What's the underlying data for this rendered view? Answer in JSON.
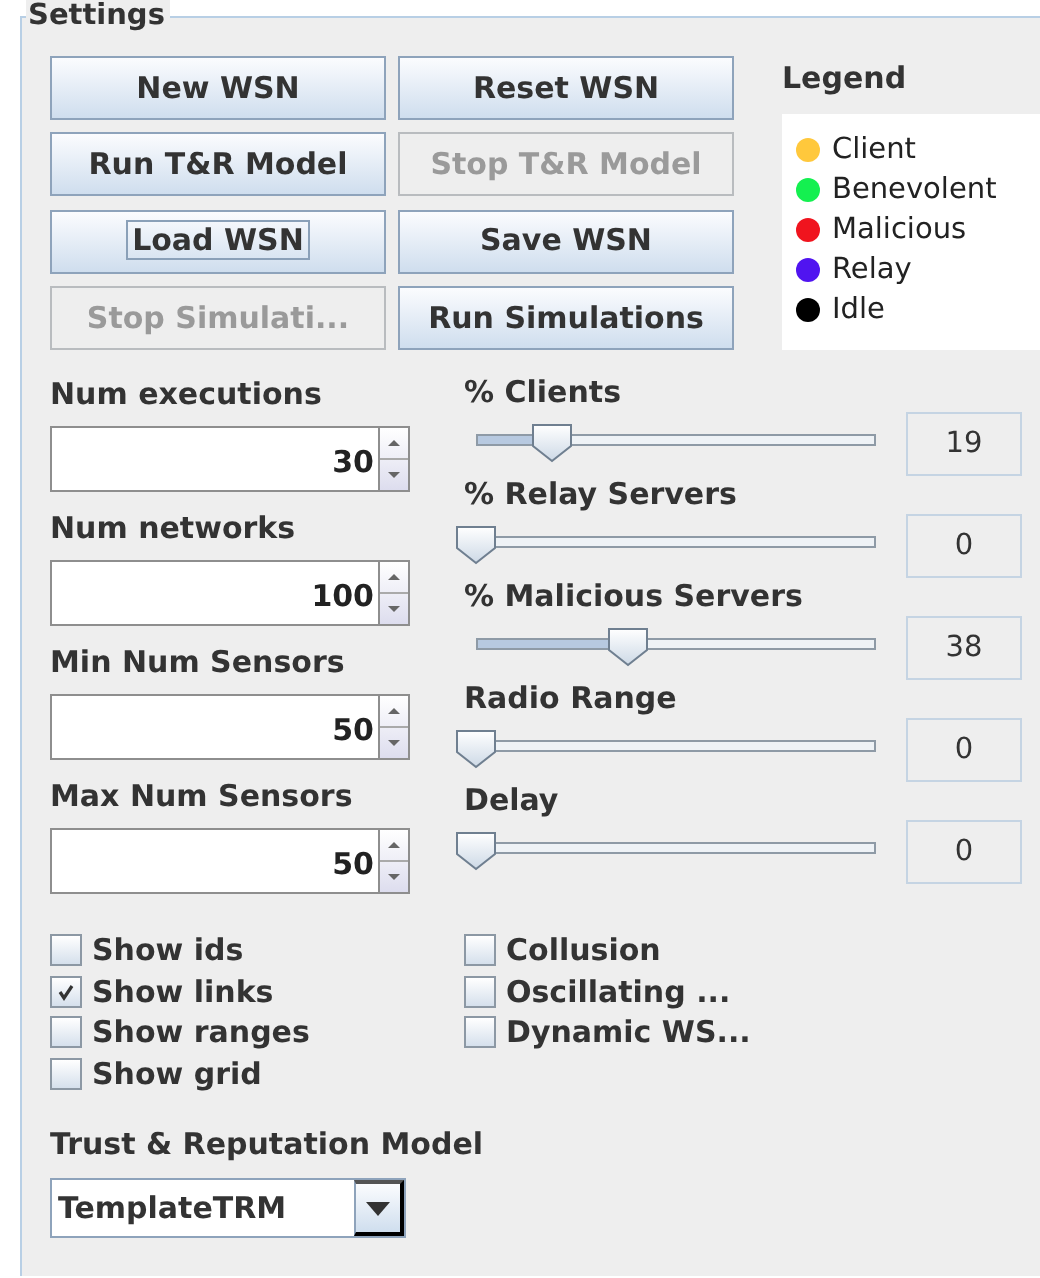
{
  "panel": {
    "title": "Settings"
  },
  "buttons": [
    {
      "label": "New WSN",
      "disabled": false,
      "focused": false
    },
    {
      "label": "Reset WSN",
      "disabled": false,
      "focused": false
    },
    {
      "label": "Run T&R Model",
      "disabled": false,
      "focused": false
    },
    {
      "label": "Stop T&R Model",
      "disabled": true,
      "focused": false
    },
    {
      "label": "Load WSN",
      "disabled": false,
      "focused": true
    },
    {
      "label": "Save WSN",
      "disabled": false,
      "focused": false
    },
    {
      "label": "Stop Simulati...",
      "disabled": true,
      "focused": false
    },
    {
      "label": "Run Simulations",
      "disabled": false,
      "focused": false
    }
  ],
  "legend": {
    "title": "Legend",
    "items": [
      {
        "label": "Client",
        "color": "#ffc83c"
      },
      {
        "label": "Benevolent",
        "color": "#14f050"
      },
      {
        "label": "Malicious",
        "color": "#f0141e"
      },
      {
        "label": "Relay",
        "color": "#5014f0"
      },
      {
        "label": "Idle",
        "color": "#000000"
      }
    ]
  },
  "spinners": [
    {
      "label": "Num executions",
      "value": "30"
    },
    {
      "label": "Num networks",
      "value": "100"
    },
    {
      "label": "Min Num Sensors",
      "value": "50"
    },
    {
      "label": "Max Num Sensors",
      "value": "50"
    }
  ],
  "sliders": [
    {
      "label": "% Clients",
      "level": 0.19,
      "value": "19"
    },
    {
      "label": "% Relay Servers",
      "level": 0,
      "value": "0"
    },
    {
      "label": "% Malicious Servers",
      "level": 0.38,
      "value": "38"
    },
    {
      "label": "Radio Range",
      "level": 0,
      "value": "0"
    },
    {
      "label": "Delay",
      "level": 0,
      "value": "0"
    }
  ],
  "checkboxes_left": [
    {
      "label": "Show ids",
      "checked": false
    },
    {
      "label": "Show links",
      "checked": true
    },
    {
      "label": "Show ranges",
      "checked": false
    },
    {
      "label": "Show grid",
      "checked": false
    }
  ],
  "checkboxes_right": [
    {
      "label": "Collusion",
      "checked": false
    },
    {
      "label": "Oscillating ...",
      "checked": false
    },
    {
      "label": "Dynamic WS...",
      "checked": false
    }
  ],
  "model": {
    "label": "Trust & Reputation Model",
    "value": "TemplateTRM"
  }
}
